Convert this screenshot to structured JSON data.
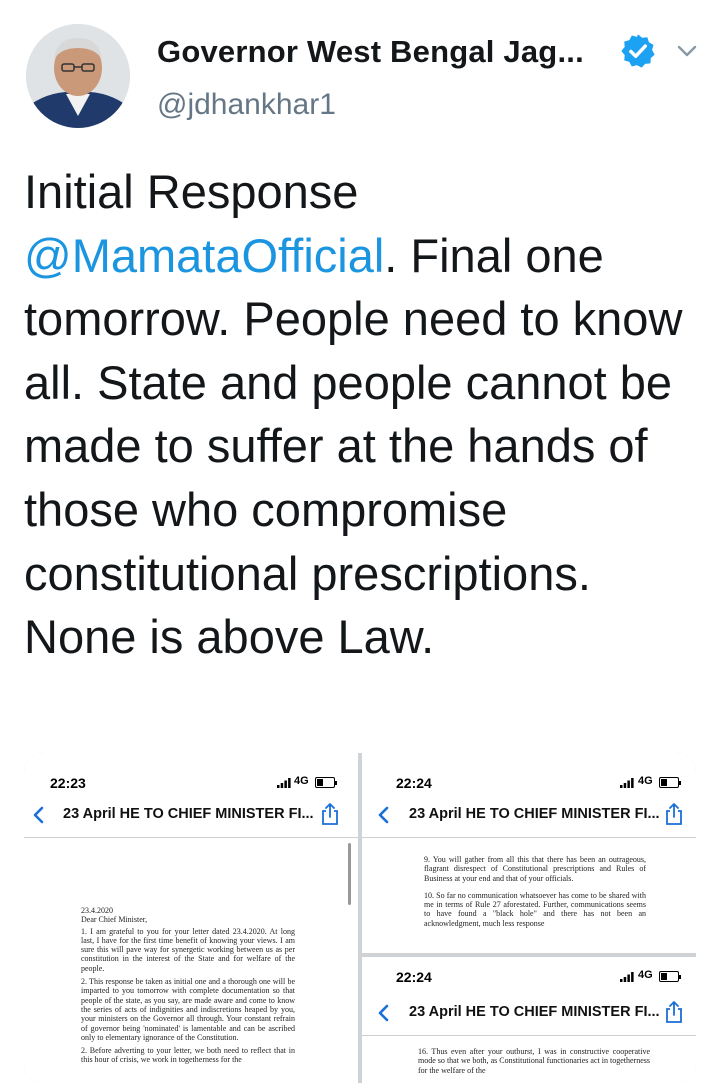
{
  "header": {
    "display_name": "Governor West Bengal Jag...",
    "handle": "@jdhankhar1",
    "verified": true,
    "menu_icon": "chevron-down-icon"
  },
  "tweet": {
    "line_start": "Initial Response",
    "mention": "@MamataOfficial",
    "text_after": ". Final one tomorrow. People need to know all. State and people cannot be made to suffer at the hands of those who compromise constitutional prescriptions. None is above Law."
  },
  "media": {
    "left": {
      "time": "22:23",
      "network": "4G",
      "title": "23 April HE TO CHIEF MINISTER FI...",
      "paragraphs": [
        "23.4.2020",
        "Dear Chief Minister,",
        "1. I am grateful to you for your letter dated 23.4.2020. At long last, I have for the first time benefit of knowing your views. I am sure this will pave way for synergetic working between us as per constitution in the interest of the State and for welfare of the people.",
        "2. This response be taken as initial one and a thorough one will be imparted to you tomorrow with complete documentation so that people of the state, as you say, are made aware and come to know the series of acts of indignities and indiscretions heaped by you, your ministers on the Governor all through. Your constant refrain of governor being 'nominated' is lamentable and can be ascribed only to elementary ignorance of the Constitution.",
        "2. Before adverting to your letter, we both need to reflect that in this hour of crisis, we work in togetherness for the"
      ]
    },
    "top_right": {
      "time": "22:24",
      "network": "4G",
      "title": "23 April HE TO CHIEF MINISTER FI...",
      "paragraphs": [
        "9. You will gather from all this that there has been an outrageous, flagrant disrespect of Constitutional prescriptions and Rules of Business at your end and that of your officials.",
        "10. So far no communication whatsoever has come to be shared with me in terms of Rule 27 aforestated. Further, communications seems to have found a \"black hole\" and there has not been an acknowledgment, much less response"
      ]
    },
    "bottom_right": {
      "time": "22:24",
      "network": "4G",
      "title": "23 April HE TO CHIEF MINISTER FI...",
      "paragraphs": [
        "16. Thus even after your outburst, I was in constructive cooperative mode so that we both, as Constitutional functionaries act in togetherness for the welfare of the"
      ]
    }
  }
}
